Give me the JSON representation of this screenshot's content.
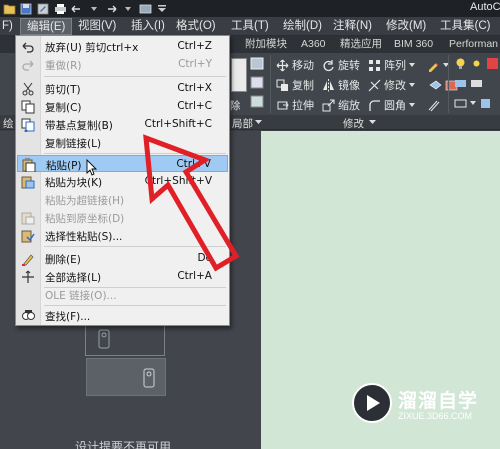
{
  "app": {
    "title": "AutoC"
  },
  "menubar": [
    {
      "label": "F)",
      "active": false
    },
    {
      "label": "编辑(E)",
      "active": true
    },
    {
      "label": "视图(V)",
      "active": false
    },
    {
      "label": "插入(I)",
      "active": false
    },
    {
      "label": "格式(O)",
      "active": false
    },
    {
      "label": "工具(T)",
      "active": false
    },
    {
      "label": "绘制(D)",
      "active": false
    },
    {
      "label": "注释(N)",
      "active": false
    },
    {
      "label": "修改(M)",
      "active": false
    },
    {
      "label": "工具集(C)",
      "active": false
    }
  ],
  "tabs": [
    "附加模块",
    "A360",
    "精选应用",
    "BIM 360",
    "Performan"
  ],
  "ribbon": {
    "modify_tools": [
      {
        "label": "移动",
        "icon": "move-icon"
      },
      {
        "label": "旋转",
        "icon": "rotate-icon"
      },
      {
        "label": "阵列",
        "icon": "array-icon"
      },
      {
        "label": "复制",
        "icon": "copy-icon"
      },
      {
        "label": "镜像",
        "icon": "mirror-icon"
      },
      {
        "label": "修改",
        "icon": "fillet-icon"
      },
      {
        "label": "拉伸",
        "icon": "stretch-icon"
      },
      {
        "label": "缩放",
        "icon": "scale-icon"
      },
      {
        "label": "圆角",
        "icon": "fillet-icon"
      }
    ],
    "panel_labels": {
      "left": "绘",
      "clip": "局部",
      "modify": "修改"
    },
    "left_fragment": "除"
  },
  "edit_menu": {
    "items": [
      {
        "label": "放弃(U) 剪切ctrl+x",
        "shortcut": "Ctrl+Z",
        "icon": "undo-icon",
        "disabled": false
      },
      {
        "label": "重做(R)",
        "shortcut": "Ctrl+Y",
        "icon": "redo-icon",
        "disabled": true
      },
      {
        "label": "剪切(T)",
        "shortcut": "Ctrl+X",
        "icon": "scissors-icon",
        "disabled": false
      },
      {
        "label": "复制(C)",
        "shortcut": "Ctrl+C",
        "icon": "copy-icon",
        "disabled": false
      },
      {
        "label": "带基点复制(B)",
        "shortcut": "Ctrl+Shift+C",
        "icon": "copy-base-icon",
        "disabled": false
      },
      {
        "label": "复制链接(L)",
        "shortcut": "",
        "icon": "",
        "disabled": false
      },
      {
        "label": "粘贴(P)",
        "shortcut": "Ctrl+V",
        "icon": "paste-icon",
        "disabled": false,
        "highlighted": true
      },
      {
        "label": "粘贴为块(K)",
        "shortcut": "Ctrl+Shift+V",
        "icon": "paste-block-icon",
        "disabled": false
      },
      {
        "label": "粘贴为超链接(H)",
        "shortcut": "",
        "icon": "",
        "disabled": true
      },
      {
        "label": "粘贴到原坐标(D)",
        "shortcut": "",
        "icon": "paste-original-icon",
        "disabled": true
      },
      {
        "label": "选择性粘贴(S)...",
        "shortcut": "",
        "icon": "paste-special-icon",
        "disabled": false
      },
      {
        "label": "删除(E)",
        "shortcut": "De",
        "icon": "eraser-icon",
        "disabled": false
      },
      {
        "label": "全部选择(L)",
        "shortcut": "Ctrl+A",
        "icon": "select-all-icon",
        "disabled": false
      },
      {
        "label": "OLE 链接(O)...",
        "shortcut": "",
        "icon": "",
        "disabled": true
      },
      {
        "label": "查找(F)...",
        "shortcut": "",
        "icon": "find-icon",
        "disabled": false
      }
    ]
  },
  "workspace": {
    "bottom_text": "设计提要不再可用"
  },
  "watermark": {
    "title": "溜溜自学",
    "subtitle": "ZIXUE.3D66.COM"
  },
  "colors": {
    "accent_arrow": "#e01f26",
    "menu_highlight": "#9fcaf3",
    "canvas_bg": "#d1e6d5"
  }
}
